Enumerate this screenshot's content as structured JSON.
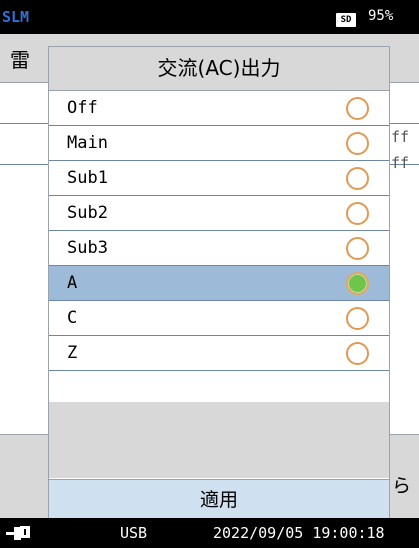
{
  "status": {
    "app": "SLM",
    "sd": "SD",
    "battery": "95%"
  },
  "background": {
    "header_char": "雷",
    "row_values": [
      "ff",
      "ff"
    ],
    "footer_char": "ら"
  },
  "dialog": {
    "title": "交流(AC)出力",
    "options": [
      {
        "label": "Off",
        "selected": false
      },
      {
        "label": "Main",
        "selected": false
      },
      {
        "label": "Sub1",
        "selected": false
      },
      {
        "label": "Sub2",
        "selected": false
      },
      {
        "label": "Sub3",
        "selected": false
      },
      {
        "label": "A",
        "selected": true
      },
      {
        "label": "C",
        "selected": false
      },
      {
        "label": "Z",
        "selected": false
      }
    ],
    "apply_label": "適用"
  },
  "footer": {
    "usb": "USB",
    "datetime": "2022/09/05 19:00:18"
  },
  "colors": {
    "selected_row": "#9dbad9",
    "radio_on": "#6fc44a",
    "radio_ring": "#e19a55",
    "app_name": "#2f6fd6"
  }
}
